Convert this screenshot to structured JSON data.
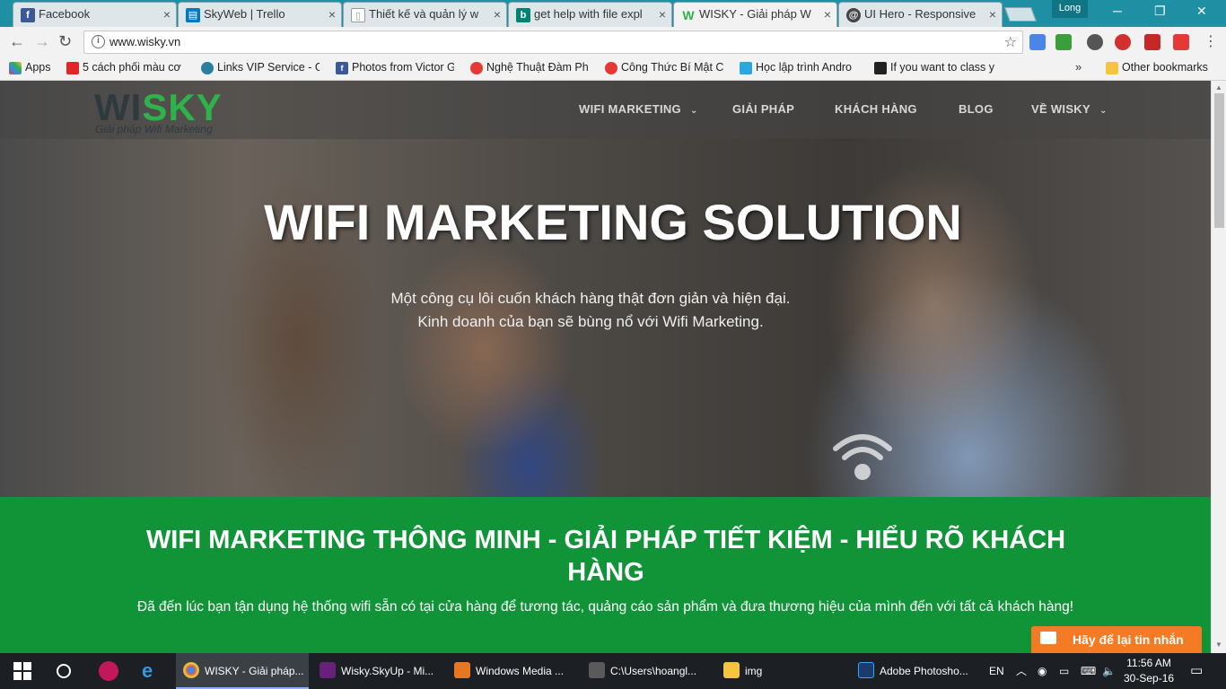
{
  "browser": {
    "tabs": [
      {
        "title": "Facebook",
        "icon": "facebook-icon",
        "color": "#3b5998",
        "glyph": "f"
      },
      {
        "title": "SkyWeb | Trello",
        "icon": "trello-icon",
        "color": "#0079bf",
        "glyph": "▤"
      },
      {
        "title": "Thiết kế và quản lý w",
        "icon": "document-icon",
        "color": "#9e9e9e",
        "glyph": "▯"
      },
      {
        "title": "get help with file expl",
        "icon": "bing-icon",
        "color": "#008373",
        "glyph": "b"
      },
      {
        "title": "WISKY - Giải pháp W",
        "icon": "wisky-icon",
        "color": "#2fb24a",
        "glyph": "W"
      },
      {
        "title": "UI Hero - Responsive",
        "icon": "uihero-icon",
        "color": "#444444",
        "glyph": "@"
      }
    ],
    "profile_name": "Long",
    "url": "www.wisky.vn",
    "bookmarks": [
      {
        "label": "Apps",
        "icon": "apps-grid-icon",
        "color": "#e0442d"
      },
      {
        "label": "5 cách phối màu cơ",
        "icon": "bookmark-red-icon",
        "color": "#e02727"
      },
      {
        "label": "Links VIP Service - G",
        "icon": "cloud-icon",
        "color": "#2a7fa0"
      },
      {
        "label": "Photos from Victor G",
        "icon": "facebook-icon",
        "color": "#3b5998"
      },
      {
        "label": "Nghệ Thuật Đàm Ph",
        "icon": "red-circle-icon",
        "color": "#e53935"
      },
      {
        "label": "Công Thức Bí Mật C",
        "icon": "red-circle-icon",
        "color": "#e53935"
      },
      {
        "label": "Học lập trình Andro",
        "icon": "tutorial-icon",
        "color": "#29a8e0"
      },
      {
        "label": "If you want to class y",
        "icon": "stack-icon",
        "color": "#222222"
      },
      {
        "label": "Other bookmarks",
        "icon": "folder-icon",
        "color": "#f5c542"
      }
    ],
    "bookmarks_overflow": "»"
  },
  "site": {
    "logo_text_dark": "WI",
    "logo_text_green": "SKY",
    "logo_tagline": "Giải pháp Wifi Marketing",
    "menu": [
      {
        "label": "WIFI MARKETING",
        "has_dropdown": true
      },
      {
        "label": "GIẢI PHÁP",
        "has_dropdown": false
      },
      {
        "label": "KHÁCH HÀNG",
        "has_dropdown": false
      },
      {
        "label": "BLOG",
        "has_dropdown": false
      },
      {
        "label": "VỀ WISKY",
        "has_dropdown": true
      }
    ],
    "hero_title": "WIFI MARKETING SOLUTION",
    "hero_sub_line1": "Một công cụ lôi cuốn khách hàng thật đơn giản và hiện đại.",
    "hero_sub_line2": "Kinh doanh của bạn sẽ bùng nổ với Wifi Marketing.",
    "section_title": "WIFI MARKETING THÔNG MINH - GIẢI PHÁP TIẾT KIỆM - HIỂU RÕ KHÁCH HÀNG",
    "section_sub": "Đã đến lúc bạn tận dụng hệ thống wifi sẵn có tại cửa hàng để tương tác, quảng cáo sản phẩm và đưa thương hiệu của mình đến với tất cả khách hàng!",
    "chat_button": "Hãy để lại tin nhắn",
    "brand_green": "#119438",
    "accent_orange": "#f47b24"
  },
  "taskbar": {
    "tasks": [
      {
        "label": "WISKY - Giải pháp...",
        "icon": "chrome-icon",
        "color": "#dd4b39"
      },
      {
        "label": "Wisky.SkyUp - Mi...",
        "icon": "visual-studio-icon",
        "color": "#68217a"
      },
      {
        "label": "Windows Media ...",
        "icon": "media-player-icon",
        "color": "#e87722"
      },
      {
        "label": "C:\\Users\\hoangl...",
        "icon": "terminal-icon",
        "color": "#5a5a5a"
      },
      {
        "label": "img",
        "icon": "folder-icon",
        "color": "#f5c542"
      },
      {
        "label": "Adobe Photosho...",
        "icon": "photoshop-icon",
        "color": "#1a3b6b"
      }
    ],
    "language": "EN",
    "time": "11:56 AM",
    "date": "30-Sep-16"
  }
}
